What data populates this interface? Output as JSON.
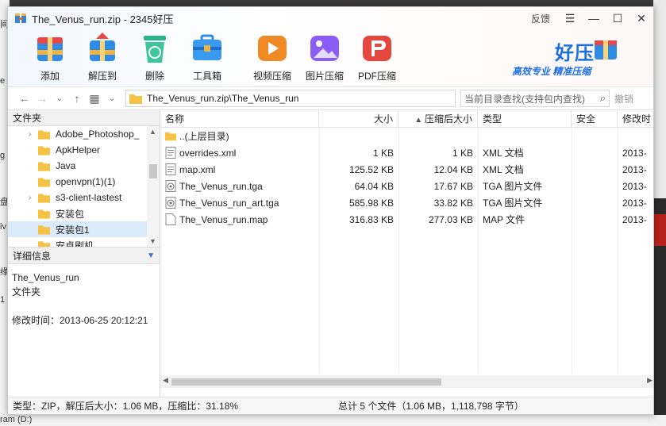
{
  "window": {
    "title": "The_Venus_run.zip - 2345好压",
    "feedback": "反馈"
  },
  "toolbar": {
    "items": [
      {
        "label": "添加",
        "icon": "add-icon",
        "color": "#e8474a"
      },
      {
        "label": "解压到",
        "icon": "extract-icon",
        "color": "#2e8be6"
      },
      {
        "label": "删除",
        "icon": "delete-icon",
        "color": "#2ab48b"
      },
      {
        "label": "工具箱",
        "icon": "toolbox-icon",
        "color": "#2e8be6"
      },
      {
        "label": "视频压缩",
        "icon": "video-compress-icon",
        "color": "#f08a24"
      },
      {
        "label": "图片压缩",
        "icon": "image-compress-icon",
        "color": "#8b5cf6"
      },
      {
        "label": "PDF压缩",
        "icon": "pdf-compress-icon",
        "color": "#e5473f"
      }
    ],
    "brand": {
      "name": "好压",
      "slogan": "高效专业  精准压缩"
    }
  },
  "address": {
    "path": "The_Venus_run.zip\\The_Venus_run",
    "search_placeholder": "当前目录查找(支持包内查找)",
    "undo_label": "撤销"
  },
  "tree": {
    "header": "文件夹",
    "items": [
      {
        "label": "Adobe_Photoshop_",
        "expandable": true,
        "selected": false
      },
      {
        "label": "ApkHelper",
        "expandable": false,
        "selected": false
      },
      {
        "label": "Java",
        "expandable": false,
        "selected": false
      },
      {
        "label": "openvpn(1)(1)",
        "expandable": false,
        "selected": false
      },
      {
        "label": "s3-client-lastest",
        "expandable": true,
        "selected": false
      },
      {
        "label": "安装包",
        "expandable": false,
        "selected": false
      },
      {
        "label": "安装包1",
        "expandable": false,
        "selected": true
      },
      {
        "label": "安卓刷机",
        "expandable": false,
        "selected": false
      }
    ]
  },
  "details": {
    "header": "详细信息",
    "name": "The_Venus_run",
    "type": "文件夹",
    "modified": "修改时间：2013-06-25 20:12:21"
  },
  "columns": {
    "name": "名称",
    "size": "大小",
    "packed": "压缩后大小",
    "type": "类型",
    "security": "安全",
    "modified": "修改时"
  },
  "files": [
    {
      "name": "..(上层目录)",
      "kind": "folder",
      "size": "",
      "packed": "",
      "type": "",
      "modified": ""
    },
    {
      "name": "overrides.xml",
      "kind": "doc",
      "size": "1 KB",
      "packed": "1 KB",
      "type": "XML 文档",
      "modified": "2013-"
    },
    {
      "name": "map.xml",
      "kind": "doc",
      "size": "125.52 KB",
      "packed": "12.04 KB",
      "type": "XML 文档",
      "modified": "2013-"
    },
    {
      "name": "The_Venus_run.tga",
      "kind": "image",
      "size": "64.04 KB",
      "packed": "17.67 KB",
      "type": "TGA 图片文件",
      "modified": "2013-"
    },
    {
      "name": "The_Venus_run_art.tga",
      "kind": "image",
      "size": "585.98 KB",
      "packed": "33.82 KB",
      "type": "TGA 图片文件",
      "modified": "2013-"
    },
    {
      "name": "The_Venus_run.map",
      "kind": "blank",
      "size": "316.83 KB",
      "packed": "277.03 KB",
      "type": "MAP 文件",
      "modified": "2013-"
    }
  ],
  "status": {
    "left": "类型：ZIP，解压后大小：1.06 MB，压缩比：31.18%",
    "right": "总计 5 个文件（1.06 MB，1,118,798 字节）"
  },
  "desktop": {
    "bottom_text": "ram (D:)"
  }
}
